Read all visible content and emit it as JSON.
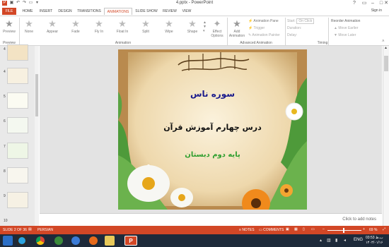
{
  "window": {
    "title": "4.pptx - PowerPoint",
    "signin": "Sign in"
  },
  "tabs": [
    "FILE",
    "HOME",
    "INSERT",
    "DESIGN",
    "TRANSITIONS",
    "ANIMATIONS",
    "SLIDE SHOW",
    "REVIEW",
    "VIEW"
  ],
  "ribbon": {
    "preview_label": "Preview",
    "effects": [
      "None",
      "Appear",
      "Fade",
      "Fly In",
      "Float In",
      "Split",
      "Wipe",
      "Shape"
    ],
    "effect_options": "Effect Options",
    "add_animation": "Add Animation",
    "animation_pane": "Animation Pane",
    "trigger": "Trigger",
    "animation_painter": "Animation Painter",
    "start": "Start:",
    "start_value": "On Click",
    "duration": "Duration:",
    "delay": "Delay:",
    "reorder": "Reorder Animation",
    "move_earlier": "Move Earlier",
    "move_later": "Move Later",
    "groups": {
      "preview": "Preview",
      "animation": "Animation",
      "advanced": "Advanced Animation",
      "timing": "Timing"
    }
  },
  "thumbnails": [
    "4",
    "5",
    "6",
    "7",
    "8",
    "9",
    "10"
  ],
  "slide": {
    "line1": "سوره ناس",
    "line2": "درس چهارم آموزش قرآن",
    "line3": "پایه دوم دبستان"
  },
  "notes_placeholder": "Click to add notes",
  "status": {
    "slide_of": "SLIDE 2 OF 36",
    "language": "PERSIAN",
    "notes": "NOTES",
    "comments": "COMMENTS",
    "zoom": "69 %"
  },
  "taskbar": {
    "lang": "ENG",
    "time": "03:53 ب.ظ",
    "date": "۱۴۰۳/۰۱/۱۶"
  },
  "colors": {
    "accent": "#d24726",
    "taskbar": "#1e2a3a",
    "slide_title": "#1a1a8c",
    "slide_green": "#2e9e2e"
  }
}
